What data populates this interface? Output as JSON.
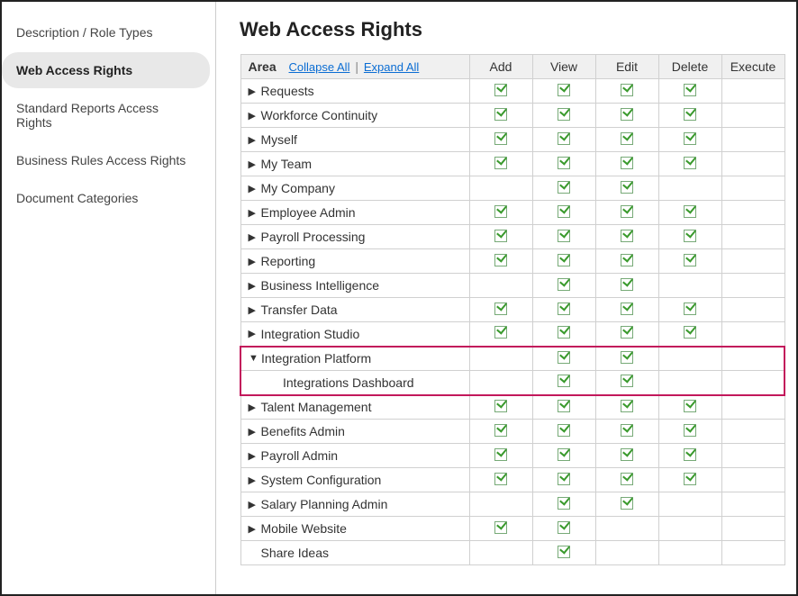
{
  "sidebar": {
    "items": [
      {
        "label": "Description / Role Types",
        "active": false
      },
      {
        "label": "Web Access Rights",
        "active": true
      },
      {
        "label": "Standard Reports Access Rights",
        "active": false
      },
      {
        "label": "Business Rules Access Rights",
        "active": false
      },
      {
        "label": "Document Categories",
        "active": false
      }
    ]
  },
  "page": {
    "title": "Web Access Rights"
  },
  "table": {
    "area_label": "Area",
    "collapse_label": "Collapse All",
    "expand_label": "Expand All",
    "columns": [
      "Add",
      "View",
      "Edit",
      "Delete",
      "Execute"
    ],
    "rows": [
      {
        "label": "Requests",
        "expand": "right",
        "indent": 0,
        "perms": [
          true,
          true,
          true,
          true,
          false
        ],
        "hl": ""
      },
      {
        "label": "Workforce Continuity",
        "expand": "right",
        "indent": 0,
        "perms": [
          true,
          true,
          true,
          true,
          false
        ],
        "hl": ""
      },
      {
        "label": "Myself",
        "expand": "right",
        "indent": 0,
        "perms": [
          true,
          true,
          true,
          true,
          false
        ],
        "hl": ""
      },
      {
        "label": "My Team",
        "expand": "right",
        "indent": 0,
        "perms": [
          true,
          true,
          true,
          true,
          false
        ],
        "hl": ""
      },
      {
        "label": "My Company",
        "expand": "right",
        "indent": 0,
        "perms": [
          false,
          true,
          true,
          false,
          false
        ],
        "hl": ""
      },
      {
        "label": "Employee Admin",
        "expand": "right",
        "indent": 0,
        "perms": [
          true,
          true,
          true,
          true,
          false
        ],
        "hl": ""
      },
      {
        "label": "Payroll Processing",
        "expand": "right",
        "indent": 0,
        "perms": [
          true,
          true,
          true,
          true,
          false
        ],
        "hl": ""
      },
      {
        "label": "Reporting",
        "expand": "right",
        "indent": 0,
        "perms": [
          true,
          true,
          true,
          true,
          false
        ],
        "hl": ""
      },
      {
        "label": "Business Intelligence",
        "expand": "right",
        "indent": 0,
        "perms": [
          false,
          true,
          true,
          false,
          false
        ],
        "hl": ""
      },
      {
        "label": "Transfer Data",
        "expand": "right",
        "indent": 0,
        "perms": [
          true,
          true,
          true,
          true,
          false
        ],
        "hl": ""
      },
      {
        "label": "Integration Studio",
        "expand": "right",
        "indent": 0,
        "perms": [
          true,
          true,
          true,
          true,
          false
        ],
        "hl": ""
      },
      {
        "label": "Integration Platform",
        "expand": "down",
        "indent": 0,
        "perms": [
          false,
          true,
          true,
          false,
          false
        ],
        "hl": "top"
      },
      {
        "label": "Integrations Dashboard",
        "expand": "none",
        "indent": 1,
        "perms": [
          false,
          true,
          true,
          false,
          false
        ],
        "hl": "bottom"
      },
      {
        "label": "Talent Management",
        "expand": "right",
        "indent": 0,
        "perms": [
          true,
          true,
          true,
          true,
          false
        ],
        "hl": ""
      },
      {
        "label": "Benefits Admin",
        "expand": "right",
        "indent": 0,
        "perms": [
          true,
          true,
          true,
          true,
          false
        ],
        "hl": ""
      },
      {
        "label": "Payroll Admin",
        "expand": "right",
        "indent": 0,
        "perms": [
          true,
          true,
          true,
          true,
          false
        ],
        "hl": ""
      },
      {
        "label": "System Configuration",
        "expand": "right",
        "indent": 0,
        "perms": [
          true,
          true,
          true,
          true,
          false
        ],
        "hl": ""
      },
      {
        "label": "Salary Planning Admin",
        "expand": "right",
        "indent": 0,
        "perms": [
          false,
          true,
          true,
          false,
          false
        ],
        "hl": ""
      },
      {
        "label": "Mobile Website",
        "expand": "right",
        "indent": 0,
        "perms": [
          true,
          true,
          false,
          false,
          false
        ],
        "hl": ""
      },
      {
        "label": "Share Ideas",
        "expand": "none",
        "indent": 0,
        "perms": [
          false,
          true,
          false,
          false,
          false
        ],
        "hl": ""
      }
    ]
  }
}
